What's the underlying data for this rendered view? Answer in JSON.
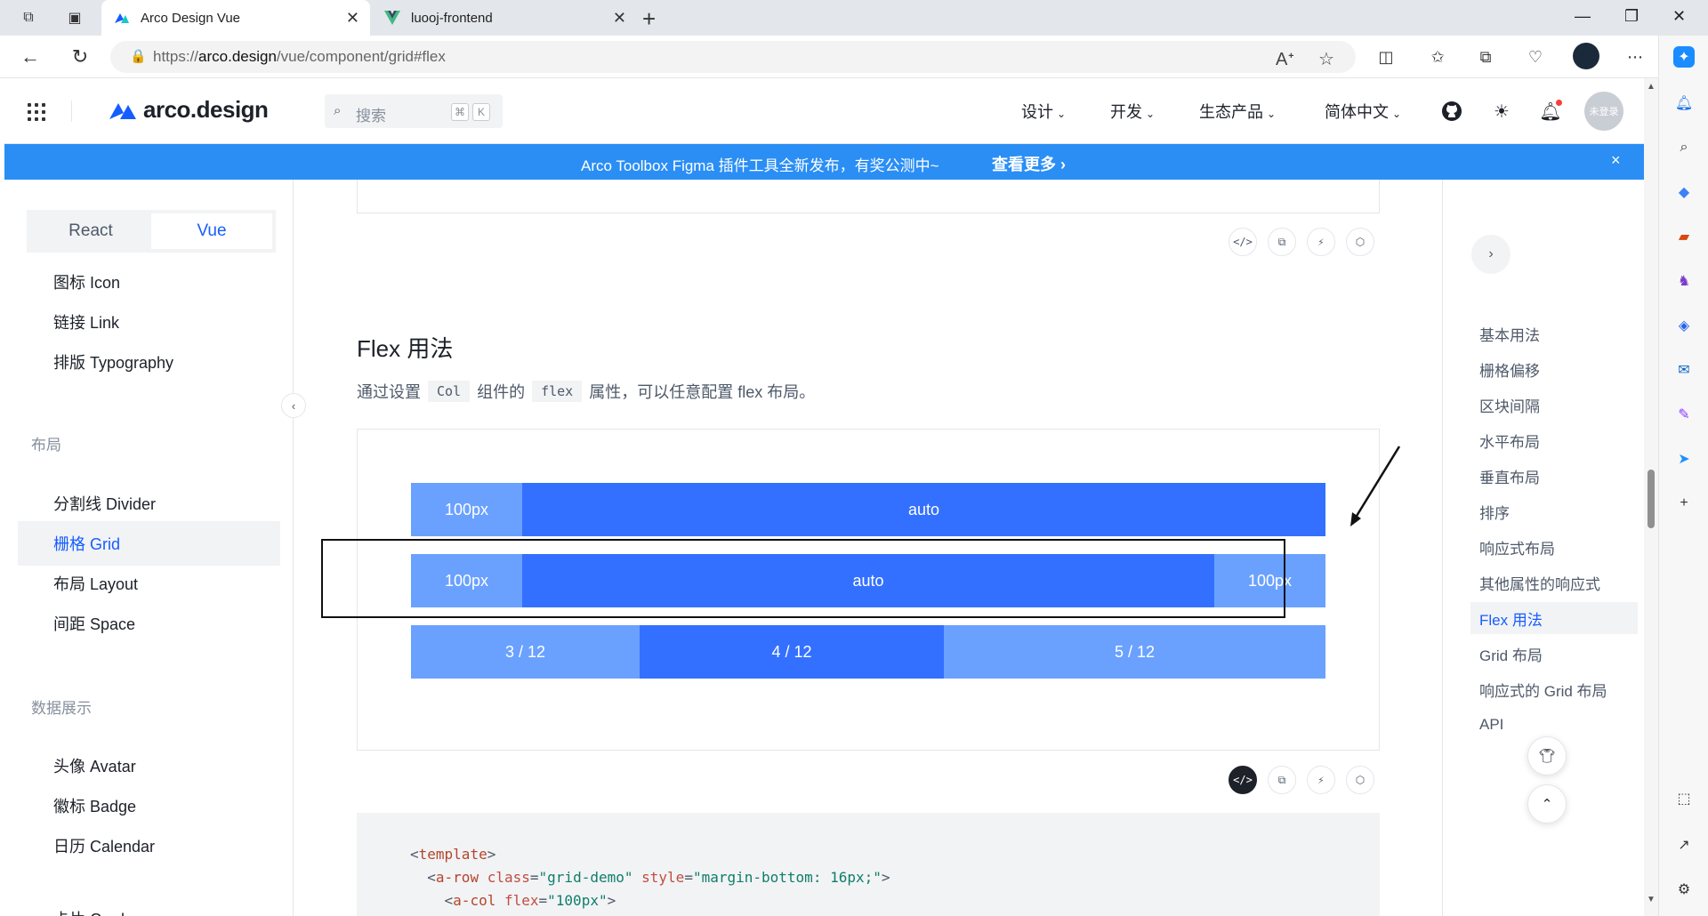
{
  "browser": {
    "tabs": [
      {
        "title": "Arco Design Vue",
        "active": true
      },
      {
        "title": "luooj-frontend",
        "active": false
      }
    ],
    "url": {
      "scheme": "https://",
      "host": "arco.design",
      "path": "/vue/component/grid#flex"
    }
  },
  "header": {
    "logo": "arco.design",
    "search_placeholder": "搜索",
    "search_keys": [
      "⌘",
      "K"
    ],
    "menus": [
      {
        "label": "设计"
      },
      {
        "label": "开发"
      },
      {
        "label": "生态产品"
      },
      {
        "label": "简体中文"
      }
    ],
    "user_label": "未登录"
  },
  "banner": {
    "message": "Arco Toolbox Figma 插件工具全新发布，有奖公测中~",
    "link": "查看更多",
    "link_arrow": "›",
    "close": "×"
  },
  "sidebar": {
    "switch": [
      "React",
      "Vue"
    ],
    "items": [
      {
        "type": "item",
        "label": "图标 Icon"
      },
      {
        "type": "item",
        "label": "链接 Link"
      },
      {
        "type": "item",
        "label": "排版 Typography"
      },
      {
        "type": "group",
        "label": "布局"
      },
      {
        "type": "item",
        "label": "分割线 Divider"
      },
      {
        "type": "item",
        "label": "栅格 Grid",
        "active": true
      },
      {
        "type": "item",
        "label": "布局 Layout"
      },
      {
        "type": "item",
        "label": "间距 Space"
      },
      {
        "type": "group",
        "label": "数据展示"
      },
      {
        "type": "item",
        "label": "头像 Avatar"
      },
      {
        "type": "item",
        "label": "徽标 Badge"
      },
      {
        "type": "item",
        "label": "日历 Calendar"
      },
      {
        "type": "item",
        "label": "卡片 Card"
      }
    ]
  },
  "main": {
    "section_title": "Flex 用法",
    "desc": {
      "before": "通过设置",
      "code1": "Col",
      "middle": "组件的",
      "code2": "flex",
      "after": "属性，可以任意配置 flex 布局。"
    },
    "demo_rows": [
      {
        "cells": [
          {
            "label": "100px"
          },
          {
            "label": "auto"
          }
        ]
      },
      {
        "cells": [
          {
            "label": "100px"
          },
          {
            "label": "auto"
          },
          {
            "label": "100px"
          }
        ]
      },
      {
        "cells": [
          {
            "label": "3 / 12"
          },
          {
            "label": "4 / 12"
          },
          {
            "label": "5 / 12"
          }
        ]
      }
    ],
    "code_lines": [
      "<template>",
      "  <a-row class=\"grid-demo\" style=\"margin-bottom: 16px;\">",
      "    <a-col flex=\"100px\">"
    ]
  },
  "toc": {
    "items": [
      {
        "label": "基本用法"
      },
      {
        "label": "栅格偏移"
      },
      {
        "label": "区块间隔"
      },
      {
        "label": "水平布局"
      },
      {
        "label": "垂直布局"
      },
      {
        "label": "排序"
      },
      {
        "label": "响应式布局"
      },
      {
        "label": "其他属性的响应式"
      },
      {
        "label": "Flex 用法",
        "active": true
      },
      {
        "label": "Grid 布局"
      },
      {
        "label": "响应式的 Grid 布局"
      },
      {
        "label": "API"
      }
    ]
  },
  "colors": {
    "primary": "#165dff",
    "banner": "#2a8ef5",
    "bar_light": "#6aa1ff",
    "bar_dark": "#3370ff"
  }
}
